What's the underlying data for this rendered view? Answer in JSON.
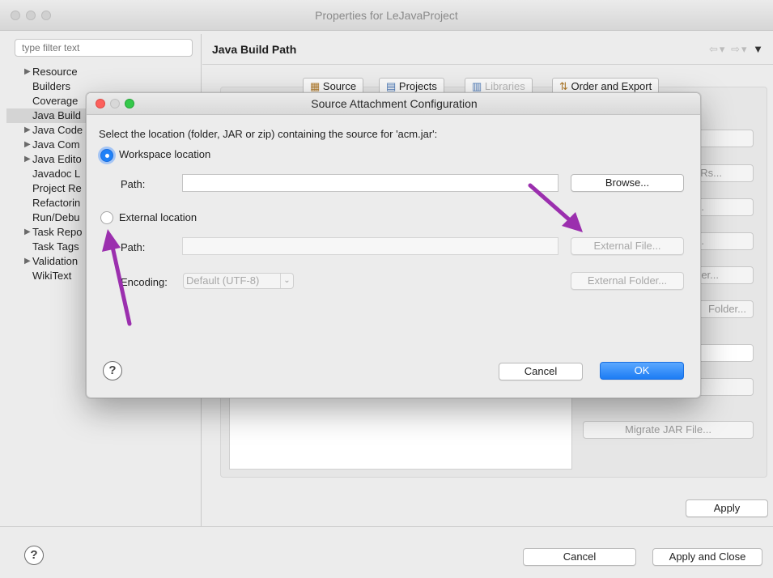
{
  "window": {
    "title": "Properties for LeJavaProject"
  },
  "sidebar": {
    "filter_placeholder": "type filter text",
    "items": [
      {
        "label": "Resource",
        "expandable": true
      },
      {
        "label": "Builders",
        "expandable": false
      },
      {
        "label": "Coverage",
        "expandable": false
      },
      {
        "label": "Java Build",
        "expandable": false,
        "selected": true
      },
      {
        "label": "Java Code",
        "expandable": true
      },
      {
        "label": "Java Com",
        "expandable": true
      },
      {
        "label": "Java Edito",
        "expandable": true
      },
      {
        "label": "Javadoc L",
        "expandable": false
      },
      {
        "label": "Project Re",
        "expandable": false
      },
      {
        "label": "Refactorin",
        "expandable": false
      },
      {
        "label": "Run/Debu",
        "expandable": false
      },
      {
        "label": "Task Repo",
        "expandable": true
      },
      {
        "label": "Task Tags",
        "expandable": false
      },
      {
        "label": "Validation",
        "expandable": true
      },
      {
        "label": "WikiText",
        "expandable": false
      }
    ]
  },
  "page": {
    "title": "Java Build Path",
    "tabs": [
      "Source",
      "Projects",
      "Libraries",
      "Order and Export"
    ],
    "side_buttons": [
      "Rs...",
      "...",
      "...",
      "er...",
      "Folder...",
      "Migrate JAR File..."
    ],
    "apply_label": "Apply"
  },
  "dialog": {
    "title": "Source Attachment Configuration",
    "instruction": "Select the location (folder, JAR or zip) containing the source for 'acm.jar':",
    "workspace": {
      "label": "Workspace location",
      "path_label": "Path:",
      "path_value": "",
      "browse_label": "Browse..."
    },
    "external": {
      "label": "External location",
      "path_label": "Path:",
      "path_value": "",
      "external_file_label": "External File...",
      "encoding_label": "Encoding:",
      "encoding_value": "Default (UTF-8)",
      "external_folder_label": "External Folder..."
    },
    "cancel_label": "Cancel",
    "ok_label": "OK",
    "help_glyph": "?"
  },
  "footer": {
    "cancel_label": "Cancel",
    "apply_close_label": "Apply and Close",
    "help_glyph": "?"
  },
  "colors": {
    "accent": "#1f81f7",
    "annotation_arrow": "#9b2fae"
  },
  "icons": {
    "nav_back": "back-arrow-icon",
    "nav_forward": "forward-arrow-icon",
    "menu": "view-menu-icon"
  }
}
